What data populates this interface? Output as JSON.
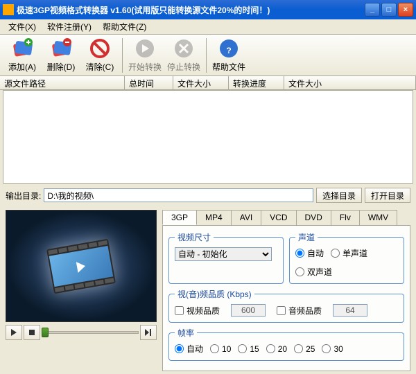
{
  "window": {
    "title": "极速3GP视频格式转换器  v1.60(试用版只能转换源文件20%的时间！)"
  },
  "menu": {
    "file": "文件(X)",
    "register": "软件注册(Y)",
    "help": "帮助文件(Z)"
  },
  "toolbar": {
    "add": "添加(A)",
    "delete": "删除(D)",
    "clear": "清除(C)",
    "start": "开始转换",
    "stop": "停止转换",
    "helpfile": "帮助文件"
  },
  "list": {
    "headers": {
      "source_path": "源文件路径",
      "total_time": "总时间",
      "file_size": "文件大小",
      "progress": "转换进度",
      "out_size": "文件大小"
    }
  },
  "output": {
    "label": "输出目录:",
    "value": "D:\\我的视频\\",
    "choose": "选择目录",
    "open": "打开目录"
  },
  "tabs": [
    "3GP",
    "MP4",
    "AVI",
    "VCD",
    "DVD",
    "Flv",
    "WMV"
  ],
  "settings": {
    "video_size_legend": "视频尺寸",
    "video_size_value": "自动 - 初始化",
    "audio_legend": "声道",
    "audio_auto": "自动",
    "audio_mono": "单声道",
    "audio_stereo": "双声道",
    "quality_legend": "视(音)频品质 (Kbps)",
    "video_quality_label": "视频品质",
    "video_quality_value": "600",
    "audio_quality_label": "音频品质",
    "audio_quality_value": "64",
    "fps_legend": "帧率",
    "fps_auto": "自动",
    "fps_options": [
      "10",
      "15",
      "20",
      "25",
      "30"
    ]
  }
}
